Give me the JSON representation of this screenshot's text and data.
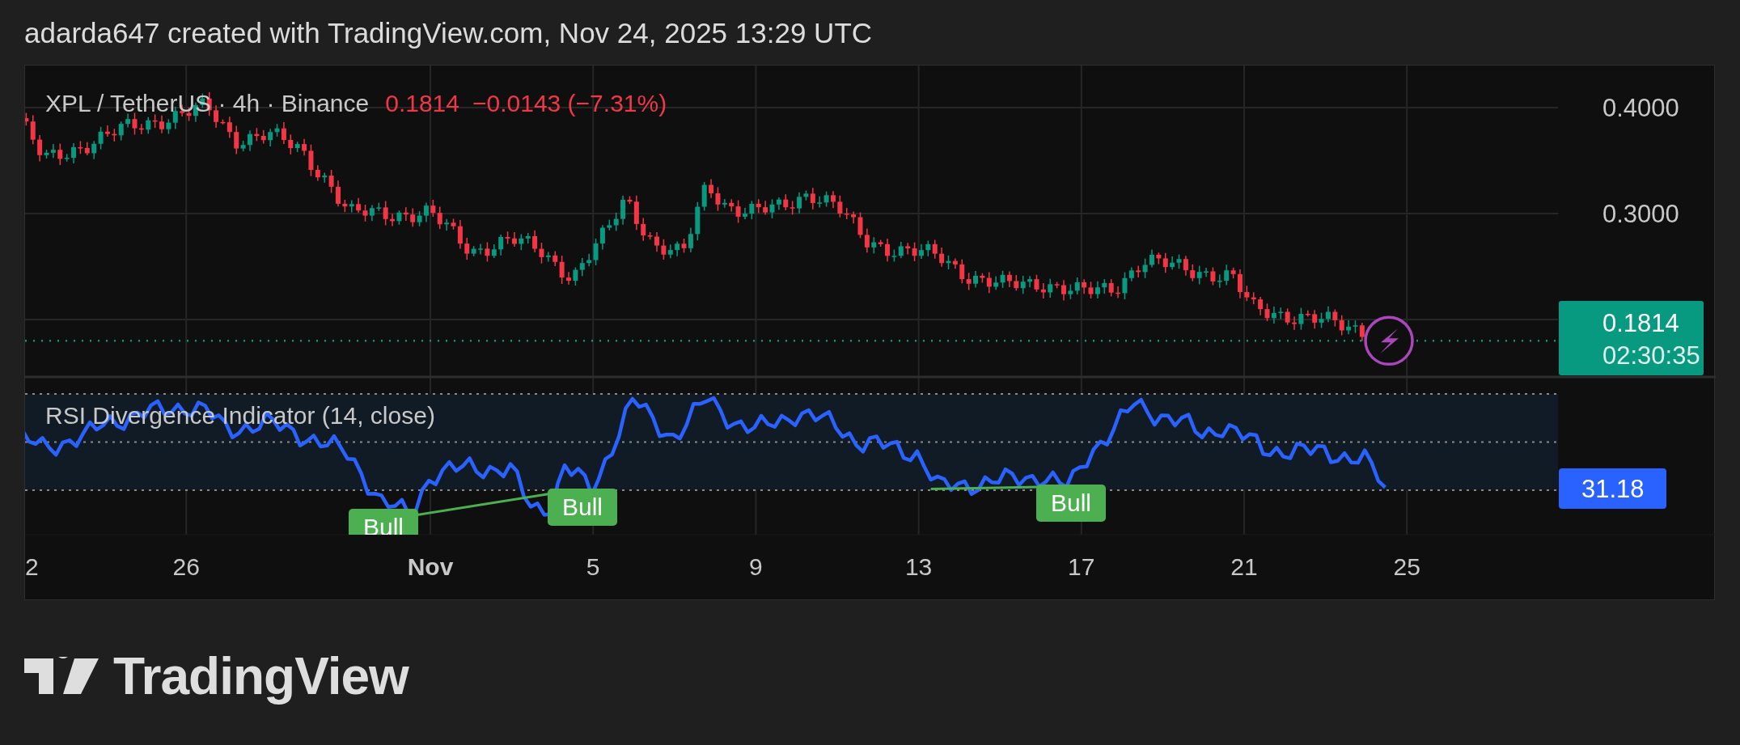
{
  "caption": "adarda647 created with TradingView.com, Nov 24, 2025 13:29 UTC",
  "chart": {
    "symbol": "XPL / TetherUS · 4h · Binance",
    "last_price": "0.1814",
    "change": "−0.0143 (−7.31%)",
    "price_axis": [
      "0.4000",
      "0.3000"
    ],
    "price_label": {
      "price": "0.1814",
      "countdown": "02:30:35"
    }
  },
  "indicator": {
    "title": "RSI Divergence Indicator (14, close)",
    "value_label": "31.18",
    "signals": [
      {
        "label": "Bull"
      },
      {
        "label": "Bull"
      },
      {
        "label": "Bull"
      }
    ]
  },
  "time_axis": [
    {
      "label": "2",
      "kind": "day"
    },
    {
      "label": "26",
      "kind": "day"
    },
    {
      "label": "Nov",
      "kind": "month"
    },
    {
      "label": "5",
      "kind": "day"
    },
    {
      "label": "9",
      "kind": "day"
    },
    {
      "label": "13",
      "kind": "day"
    },
    {
      "label": "17",
      "kind": "day"
    },
    {
      "label": "21",
      "kind": "day"
    },
    {
      "label": "25",
      "kind": "day"
    }
  ],
  "brand": "TradingView"
}
